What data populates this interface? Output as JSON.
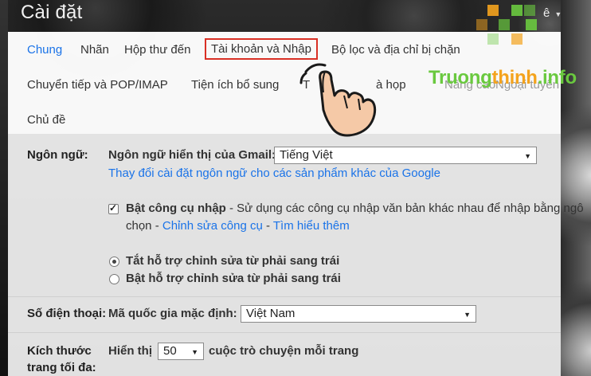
{
  "page": {
    "title": "Cài đặt",
    "account_initial": "ê"
  },
  "tabs": [
    {
      "label": "Chung",
      "active": true
    },
    {
      "label": "Nhãn"
    },
    {
      "label": "Hộp thư đến"
    },
    {
      "label": "Tài khoản và Nhập",
      "highlighted": true
    },
    {
      "label": "Bộ lọc và địa chỉ bị chặn"
    },
    {
      "label": "Chuyển tiếp và POP/IMAP"
    },
    {
      "label": "Tiện ích bổ sung"
    },
    {
      "label": "Trò chuyện và họp"
    },
    {
      "label": "Nâng cao"
    },
    {
      "label": "Ngoại tuyến"
    },
    {
      "label": "Chủ đề"
    }
  ],
  "tab_visible_text": {
    "chat_partial_left": "T",
    "chat_partial_right": "à họp",
    "advanced_partial": "Nâng cao",
    "offline_partial": "Ngoại tuyến"
  },
  "language": {
    "label": "Ngôn ngữ:",
    "display_label": "Ngôn ngữ hiển thị của Gmail:",
    "display_value": "Tiếng Việt",
    "change_link": "Thay đổi cài đặt ngôn ngữ cho các sản phẩm khác của Google",
    "input_tools_checked": true,
    "input_tools_label": "Bật công cụ nhập",
    "input_tools_desc": " - Sử dụng các công cụ nhập văn bản khác nhau để nhập bằng ngô",
    "input_tools_desc2": "chọn - ",
    "edit_tools_link": "Chỉnh sửa công cụ",
    "sep": " - ",
    "learn_more_link": "Tìm hiểu thêm",
    "rtl_off": "Tắt hỗ trợ chỉnh sửa từ phải sang trái",
    "rtl_on": "Bật hỗ trợ chỉnh sửa từ phải sang trái",
    "rtl_selected": "off"
  },
  "phone": {
    "label": "Số điện thoại:",
    "country_label": "Mã quốc gia mặc định:",
    "country_value": "Việt Nam"
  },
  "page_size": {
    "label_line1": "Kích thước",
    "label_line2": "trang tối đa:",
    "show_label": "Hiển thị",
    "value": "50",
    "suffix": "cuộc trò chuyện mỗi trang"
  },
  "watermark": {
    "part1": "Truong",
    "part2": "thinh",
    "part3": ".info"
  },
  "colors": {
    "link": "#1a73e8",
    "highlight_border": "#d93025",
    "watermark_green": "#6ac93f",
    "watermark_orange": "#f4a31d"
  }
}
